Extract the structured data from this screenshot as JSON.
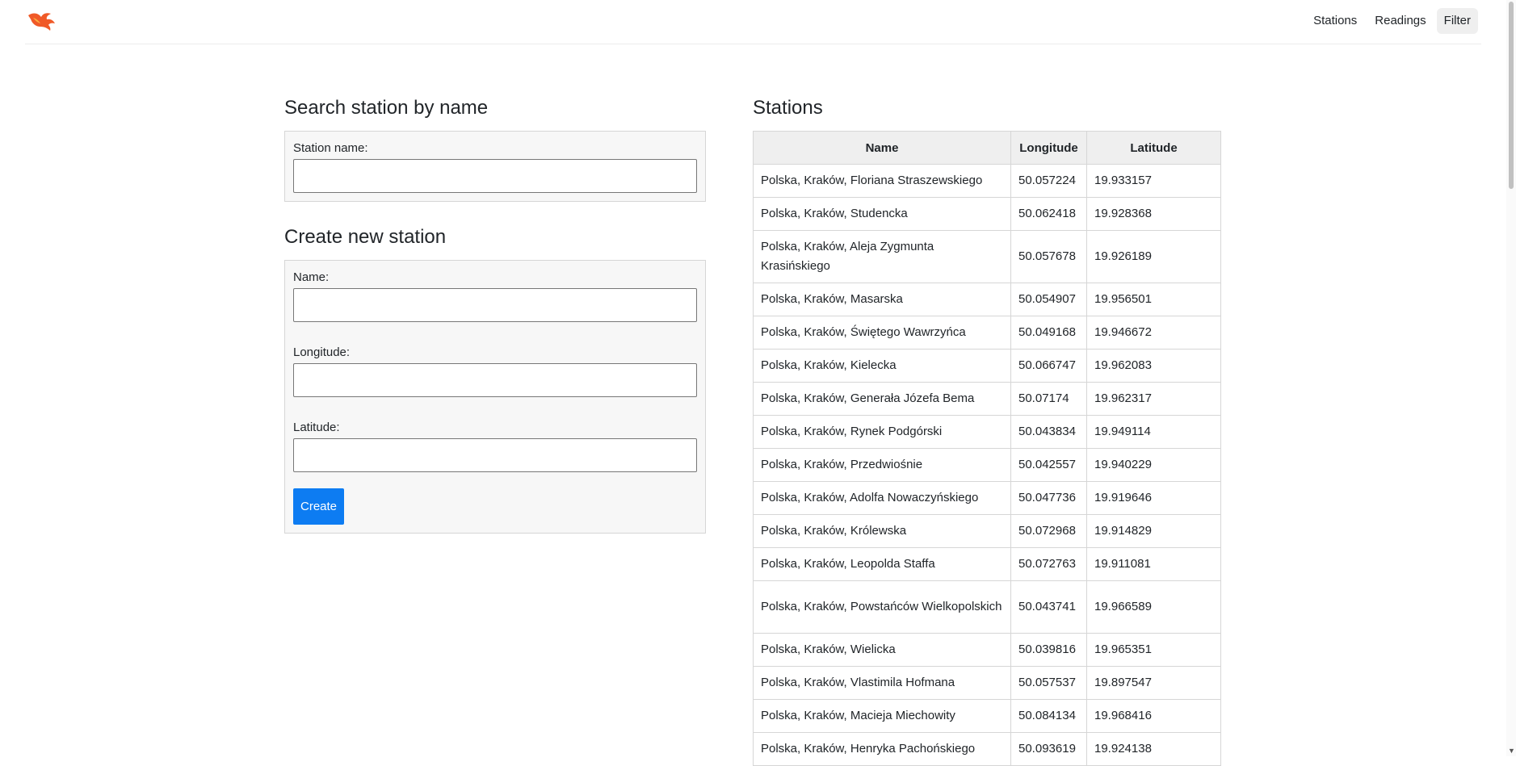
{
  "nav": {
    "logo_icon": "phoenix-flame-icon",
    "links": [
      "Stations",
      "Readings",
      "Filter"
    ]
  },
  "search": {
    "title": "Search station by name",
    "label": "Station name:",
    "value": ""
  },
  "create": {
    "title": "Create new station",
    "name_label": "Name:",
    "longitude_label": "Longitude:",
    "latitude_label": "Latitude:",
    "name_value": "",
    "longitude_value": "",
    "latitude_value": "",
    "button_label": "Create"
  },
  "stations": {
    "title": "Stations",
    "columns": [
      "Name",
      "Longitude",
      "Latitude"
    ],
    "rows": [
      {
        "name": "Polska, Kraków, Floriana Straszewskiego",
        "longitude": "50.057224",
        "latitude": "19.933157"
      },
      {
        "name": "Polska, Kraków, Studencka",
        "longitude": "50.062418",
        "latitude": "19.928368"
      },
      {
        "name": "Polska, Kraków, Aleja Zygmunta Krasińskiego",
        "longitude": "50.057678",
        "latitude": "19.926189"
      },
      {
        "name": "Polska, Kraków, Masarska",
        "longitude": "50.054907",
        "latitude": "19.956501"
      },
      {
        "name": "Polska, Kraków, Świętego Wawrzyńca",
        "longitude": "50.049168",
        "latitude": "19.946672"
      },
      {
        "name": "Polska, Kraków, Kielecka",
        "longitude": "50.066747",
        "latitude": "19.962083"
      },
      {
        "name": "Polska, Kraków, Generała Józefa Bema",
        "longitude": "50.07174",
        "latitude": "19.962317"
      },
      {
        "name": "Polska, Kraków, Rynek Podgórski",
        "longitude": "50.043834",
        "latitude": "19.949114"
      },
      {
        "name": "Polska, Kraków, Przedwiośnie",
        "longitude": "50.042557",
        "latitude": "19.940229"
      },
      {
        "name": "Polska, Kraków, Adolfa Nowaczyńskiego",
        "longitude": "50.047736",
        "latitude": "19.919646"
      },
      {
        "name": "Polska, Kraków, Królewska",
        "longitude": "50.072968",
        "latitude": "19.914829"
      },
      {
        "name": "Polska, Kraków, Leopolda Staffa",
        "longitude": "50.072763",
        "latitude": "19.911081"
      },
      {
        "name": "Polska, Kraków, Powstańców Wielkopolskich",
        "longitude": "50.043741",
        "latitude": "19.966589"
      },
      {
        "name": "Polska, Kraków, Wielicka",
        "longitude": "50.039816",
        "latitude": "19.965351"
      },
      {
        "name": "Polska, Kraków, Vlastimila Hofmana",
        "longitude": "50.057537",
        "latitude": "19.897547"
      },
      {
        "name": "Polska, Kraków, Macieja Miechowity",
        "longitude": "50.084134",
        "latitude": "19.968416"
      },
      {
        "name": "Polska, Kraków, Henryka Pachońskiego",
        "longitude": "50.093619",
        "latitude": "19.924138"
      }
    ]
  },
  "colors": {
    "accent": "#0d7cf2",
    "logo": "#f05a28"
  }
}
